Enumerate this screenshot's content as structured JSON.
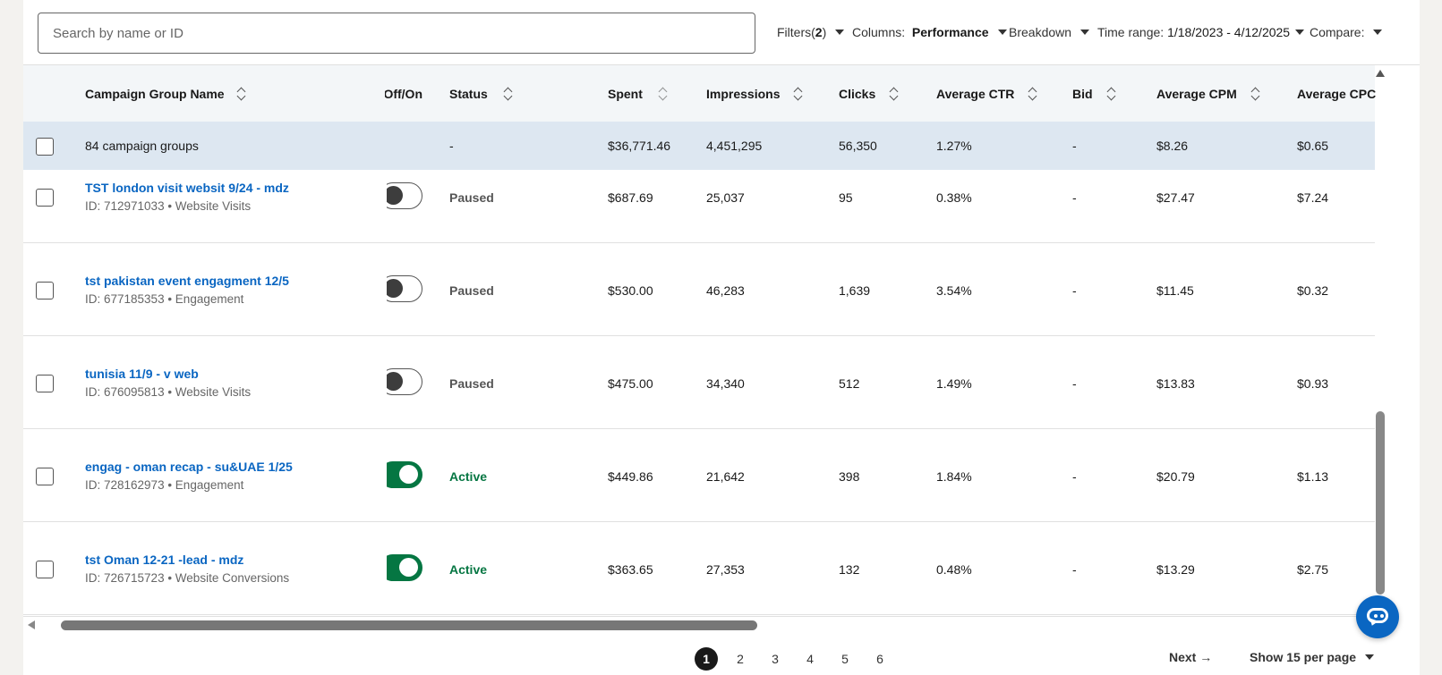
{
  "toolbar": {
    "search_placeholder": "Search by name or ID",
    "filters_label": "Filters(",
    "filters_count": "2",
    "filters_close": ")",
    "columns_label": "Columns:",
    "columns_value": "Performance",
    "breakdown_label": "Breakdown",
    "time_range_label": "Time range:",
    "time_range_value": "1/18/2023 - 4/12/2025",
    "compare_label": "Compare:"
  },
  "table": {
    "headers": {
      "name": "Campaign Group Name",
      "offon": "Off/On",
      "status": "Status",
      "spent": "Spent",
      "impressions": "Impressions",
      "clicks": "Clicks",
      "avg_ctr": "Average CTR",
      "bid": "Bid",
      "avg_cpm": "Average CPM",
      "avg_cpc": "Average CPC"
    },
    "summary": {
      "label": "84 campaign groups",
      "status": "-",
      "spent": "$36,771.46",
      "impressions": "4,451,295",
      "clicks": "56,350",
      "avg_ctr": "1.27%",
      "bid": "-",
      "avg_cpm": "$8.26",
      "avg_cpc": "$0.65"
    },
    "rows": [
      {
        "name": "TST london visit websit 9/24 - mdz",
        "sub": "ID: 712971033 • Website Visits",
        "toggle": "off",
        "status": "Paused",
        "spent": "$687.69",
        "impressions": "25,037",
        "clicks": "95",
        "avg_ctr": "0.38%",
        "bid": "-",
        "avg_cpm": "$27.47",
        "avg_cpc": "$7.24"
      },
      {
        "name": "tst pakistan event engagment 12/5",
        "sub": "ID: 677185353 • Engagement",
        "toggle": "off",
        "status": "Paused",
        "spent": "$530.00",
        "impressions": "46,283",
        "clicks": "1,639",
        "avg_ctr": "3.54%",
        "bid": "-",
        "avg_cpm": "$11.45",
        "avg_cpc": "$0.32"
      },
      {
        "name": "tunisia 11/9 - v web",
        "sub": "ID: 676095813 • Website Visits",
        "toggle": "off",
        "status": "Paused",
        "spent": "$475.00",
        "impressions": "34,340",
        "clicks": "512",
        "avg_ctr": "1.49%",
        "bid": "-",
        "avg_cpm": "$13.83",
        "avg_cpc": "$0.93"
      },
      {
        "name": "engag - oman recap - su&UAE 1/25",
        "sub": "ID: 728162973 • Engagement",
        "toggle": "on",
        "status": "Active",
        "spent": "$449.86",
        "impressions": "21,642",
        "clicks": "398",
        "avg_ctr": "1.84%",
        "bid": "-",
        "avg_cpm": "$20.79",
        "avg_cpc": "$1.13"
      },
      {
        "name": "tst Oman 12-21 -lead - mdz",
        "sub": "ID: 726715723 • Website Conversions",
        "toggle": "on",
        "status": "Active",
        "spent": "$363.65",
        "impressions": "27,353",
        "clicks": "132",
        "avg_ctr": "0.48%",
        "bid": "-",
        "avg_cpm": "$13.29",
        "avg_cpc": "$2.75"
      }
    ]
  },
  "pagination": {
    "pages": [
      "1",
      "2",
      "3",
      "4",
      "5",
      "6"
    ],
    "current": "1",
    "next_label": "Next →",
    "per_page_label": "Show 15 per page"
  },
  "colors": {
    "link": "#0a66c2",
    "active": "#057642",
    "summary_bg": "#dde7f1",
    "header_bg": "#f3f6f8"
  },
  "icons": {
    "sort": "sort-arrows-icon",
    "caret": "caret-down-icon",
    "chat": "chat-bubble-icon"
  }
}
